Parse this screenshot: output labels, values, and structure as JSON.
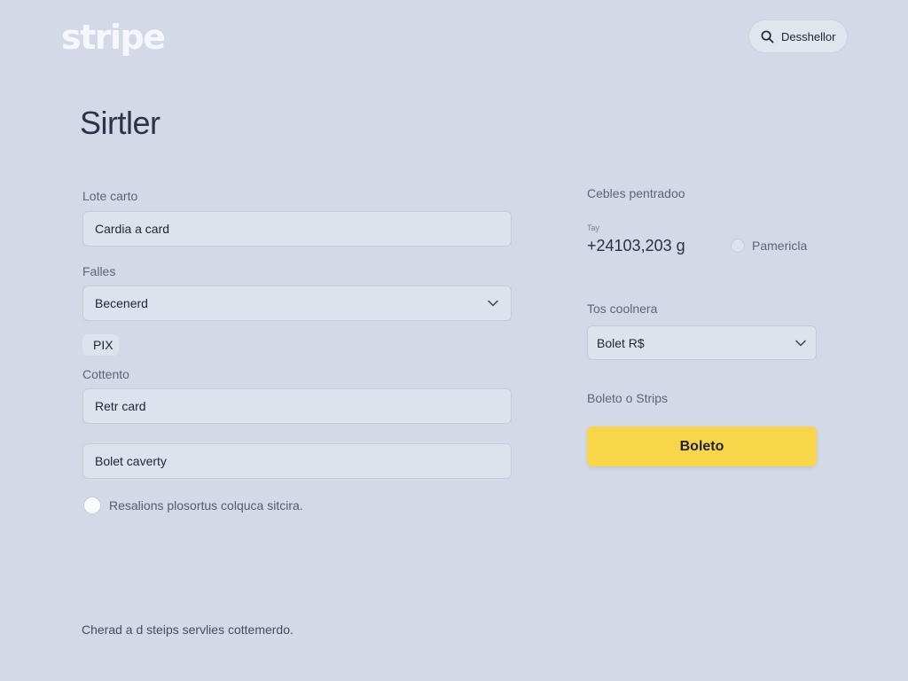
{
  "header": {
    "logo_text": "stripe",
    "search_label": "Desshellor"
  },
  "page": {
    "title": "Sirtler"
  },
  "form": {
    "card_label": "Lote carto",
    "card_value": "Cardia a card",
    "failes_label": "Falles",
    "failes_value": "Becenerd",
    "pix_label": "PIX",
    "contento_label": "Cottento",
    "retr_value": "Retr card",
    "bolet_value": "Bolet caverty",
    "checkbox_label": "Resalions plosortus colquca sitcira."
  },
  "footer": {
    "text": "Cherad a d steips servlies cottemerdo."
  },
  "summary": {
    "heading": "Cebles pentradoo",
    "tiny_label": "Tay",
    "amount": "+24103,203 g",
    "radio_label": "Pamericla",
    "select_label": "Tos coolnera",
    "select_value": "Bolet R$",
    "boleto_caption": "Boleto o Strips",
    "button_label": "Boleto"
  },
  "colors": {
    "background": "#d3d9e6",
    "accent_button": "#f9d54a",
    "input_bg": "#dde2ec"
  }
}
